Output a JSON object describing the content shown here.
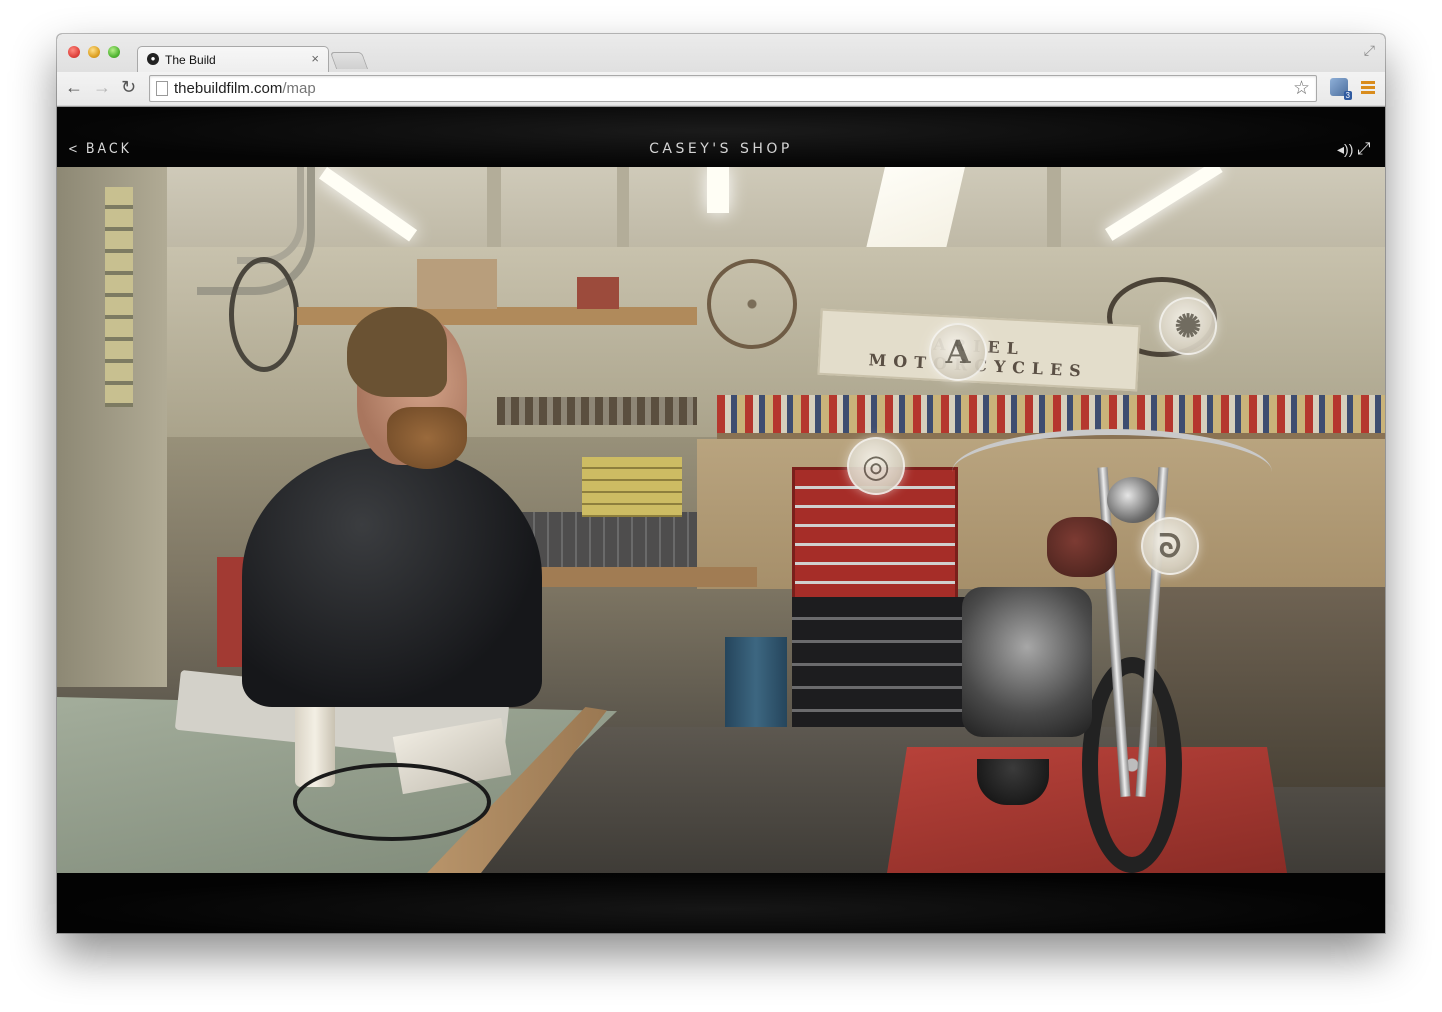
{
  "browser": {
    "tab_title": "The Build",
    "tab_close": "×",
    "url_host": "thebuildfilm.com",
    "url_path": "/map",
    "extension_badge": "3"
  },
  "header": {
    "back_label": "BACK",
    "title": "CASEY'S SHOP"
  },
  "scene": {
    "sign_text": "ARIEL MOTORCYCLES",
    "hotspots": [
      {
        "name": "hotspot-letter-a",
        "glyph": "A"
      },
      {
        "name": "hotspot-gear",
        "glyph": "✺"
      },
      {
        "name": "hotspot-nut",
        "glyph": "◎"
      },
      {
        "name": "hotspot-wrench",
        "glyph": "ᘐ"
      }
    ]
  },
  "icons": {
    "back": "back-arrow-icon",
    "forward": "forward-arrow-icon",
    "reload": "reload-icon",
    "star": "bookmark-star-icon",
    "sound": "sound-icon",
    "expand": "fullscreen-icon"
  }
}
